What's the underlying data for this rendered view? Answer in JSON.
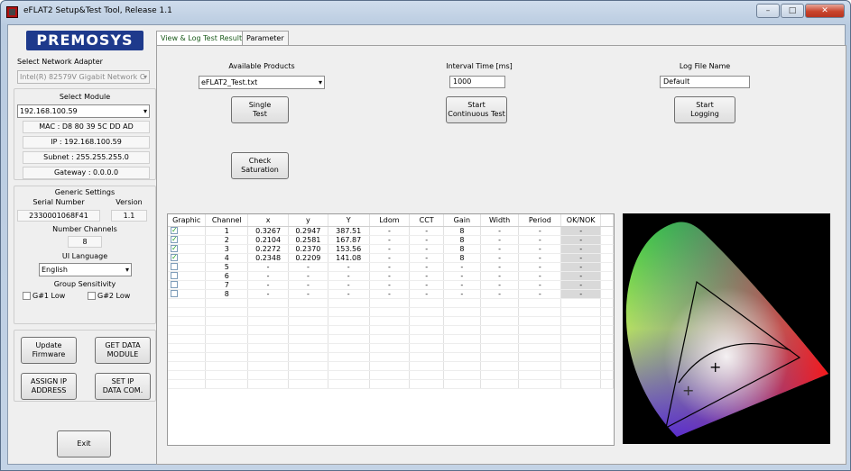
{
  "window": {
    "title": "eFLAT2 Setup&Test Tool, Release 1.1",
    "min": "–",
    "max": "□",
    "close": "✕"
  },
  "left": {
    "logo": "PREMOSYS",
    "adapter_label": "Select Network Adapter",
    "adapter_value": "Intel(R) 82579V Gigabit Network C",
    "module_label": "Select Module",
    "module_value": "192.168.100.59",
    "mac": "MAC : D8 80 39 5C DD AD",
    "ip": "IP : 192.168.100.59",
    "subnet": "Subnet : 255.255.255.0",
    "gateway": "Gateway : 0.0.0.0",
    "generic_settings": "Generic Settings",
    "serial_label": "Serial Number",
    "serial_value": "2330001068F41",
    "version_label": "Version",
    "version_value": "1.1",
    "channels_label": "Number Channels",
    "channels_value": "8",
    "ui_language_label": "UI Language",
    "ui_language_value": "English",
    "group_sensitivity": "Group Sensitivity",
    "g1": "G#1 Low",
    "g2": "G#2 Low",
    "update_firmware": "Update\nFirmware",
    "get_data_module": "GET DATA\nMODULE",
    "assign_ip": "ASSIGN IP\nADDRESS",
    "set_ip": "SET IP\nDATA COM.",
    "exit": "Exit"
  },
  "tabs": [
    {
      "label": "View & Log Test Results"
    },
    {
      "label": "Parameter"
    }
  ],
  "main": {
    "products_label": "Available Products",
    "products_value": "eFLAT2_Test.txt",
    "single_test": "Single\nTest",
    "check_saturation": "Check\nSaturation",
    "interval_label": "Interval Time [ms]",
    "interval_value": "1000",
    "start_continuous": "Start\nContinuous Test",
    "logfile_label": "Log File Name",
    "logfile_value": "Default",
    "start_logging": "Start\nLogging"
  },
  "table": {
    "headers": [
      "Graphic",
      "Channel",
      "x",
      "y",
      "Y",
      "Ldom",
      "CCT",
      "Gain",
      "Width",
      "Period",
      "OK/NOK"
    ],
    "rows": [
      {
        "checked": true,
        "cells": [
          "1",
          "0.3267",
          "0.2947",
          "387.51",
          "-",
          "-",
          "8",
          "-",
          "-",
          "-"
        ]
      },
      {
        "checked": true,
        "cells": [
          "2",
          "0.2104",
          "0.2581",
          "167.87",
          "-",
          "-",
          "8",
          "-",
          "-",
          "-"
        ]
      },
      {
        "checked": true,
        "cells": [
          "3",
          "0.2272",
          "0.2370",
          "153.56",
          "-",
          "-",
          "8",
          "-",
          "-",
          "-"
        ]
      },
      {
        "checked": true,
        "cells": [
          "4",
          "0.2348",
          "0.2209",
          "141.08",
          "-",
          "-",
          "8",
          "-",
          "-",
          "-"
        ]
      },
      {
        "checked": false,
        "cells": [
          "5",
          "-",
          "-",
          "-",
          "-",
          "-",
          "-",
          "-",
          "-",
          "-"
        ]
      },
      {
        "checked": false,
        "cells": [
          "6",
          "-",
          "-",
          "-",
          "-",
          "-",
          "-",
          "-",
          "-",
          "-"
        ]
      },
      {
        "checked": false,
        "cells": [
          "7",
          "-",
          "-",
          "-",
          "-",
          "-",
          "-",
          "-",
          "-",
          "-"
        ]
      },
      {
        "checked": false,
        "cells": [
          "8",
          "-",
          "-",
          "-",
          "-",
          "-",
          "-",
          "-",
          "-",
          "-"
        ]
      }
    ]
  },
  "cie": {
    "markers": [
      "+",
      "+"
    ]
  }
}
